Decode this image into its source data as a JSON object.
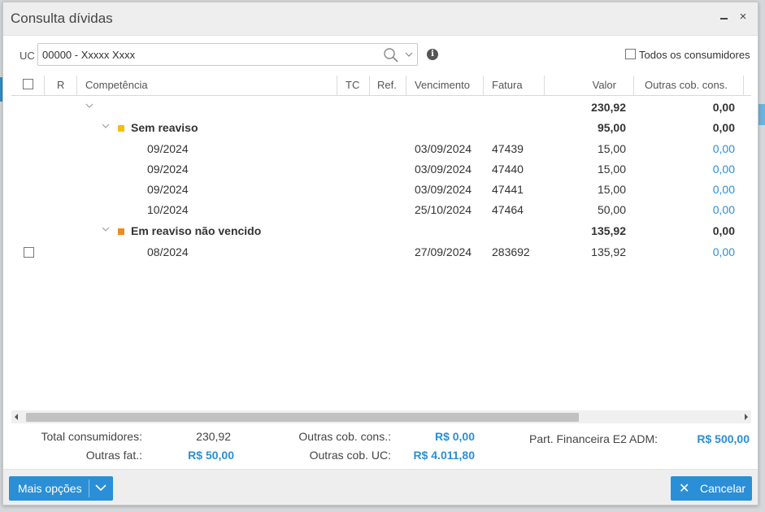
{
  "dialog": {
    "title": "Consulta dívidas",
    "close_glyph": "×"
  },
  "filter": {
    "uc_label": "UC",
    "uc_value": "00000 - Xxxxx Xxxx",
    "info_glyph": "i",
    "todos_label": "Todos os consumidores"
  },
  "columns": [
    "R",
    "Competência",
    "TC",
    "Ref.",
    "Vencimento",
    "Fatura",
    "Valor",
    "Outras cob. cons."
  ],
  "root_row": {
    "valor": "230,92",
    "outras": "0,00"
  },
  "groups": [
    {
      "label": "Sem reaviso",
      "color": "#f5c000",
      "valor": "95,00",
      "outras": "0,00",
      "rows": [
        {
          "competencia": "09/2024",
          "vencimento": "03/09/2024",
          "fatura": "47439",
          "valor": "15,00",
          "outras": "0,00"
        },
        {
          "competencia": "09/2024",
          "vencimento": "03/09/2024",
          "fatura": "47440",
          "valor": "15,00",
          "outras": "0,00"
        },
        {
          "competencia": "09/2024",
          "vencimento": "03/09/2024",
          "fatura": "47441",
          "valor": "15,00",
          "outras": "0,00"
        },
        {
          "competencia": "10/2024",
          "vencimento": "25/10/2024",
          "fatura": "47464",
          "valor": "50,00",
          "outras": "0,00"
        }
      ]
    },
    {
      "label": "Em reaviso não vencido",
      "color": "#f08a1c",
      "valor": "135,92",
      "outras": "0,00",
      "rows": [
        {
          "competencia": "08/2024",
          "vencimento": "27/09/2024",
          "fatura": "283692",
          "valor": "135,92",
          "outras": "0,00"
        }
      ]
    }
  ],
  "summary": {
    "total_consumidores_label": "Total consumidores:",
    "total_consumidores_value": "230,92",
    "outras_fat_label": "Outras fat.:",
    "outras_fat_value": "R$ 50,00",
    "outras_cob_cons_label": "Outras cob. cons.:",
    "outras_cob_cons_value": "R$ 0,00",
    "outras_cob_uc_label": "Outras cob. UC:",
    "outras_cob_uc_value": "R$ 4.011,80",
    "part_fin_label": "Part. Financeira E2 ADM:",
    "part_fin_value": "R$ 500,00"
  },
  "footer": {
    "more_label": "Mais opções",
    "cancel_label": "Cancelar",
    "cancel_glyph": "✕"
  },
  "colors": {
    "accent": "#2a8fd6",
    "link_value": "#2a8fd6"
  }
}
